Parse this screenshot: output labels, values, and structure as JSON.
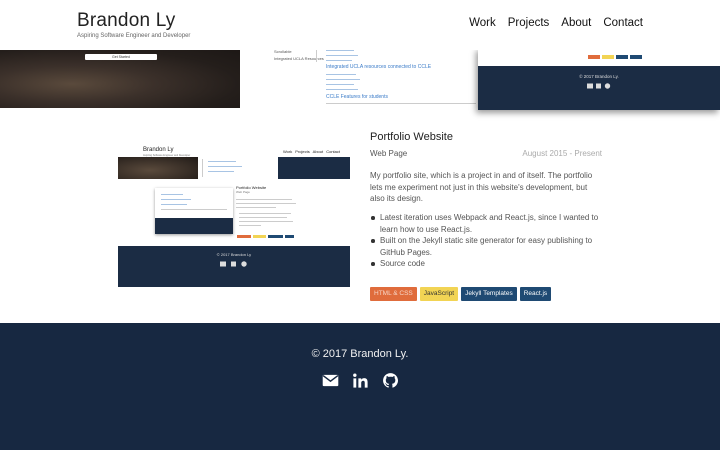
{
  "nav": {
    "brand": "Brandon Ly",
    "tagline": "Aspiring Software Engineer and Developer",
    "links": [
      "Work",
      "Projects",
      "About",
      "Contact"
    ]
  },
  "preview_strip": {
    "button_label": "Get Started",
    "items": [
      "Scrollable",
      "Integrated UCLA Resources"
    ],
    "section_heading_1": "Integrated UCLA resources connected to CCLE",
    "section_heading_2": "CCLE Features for students",
    "copyright": "© 2017 Brandon Ly."
  },
  "project": {
    "title": "Portfolio Website",
    "type": "Web Page",
    "date": "August 2015 - Present",
    "description": "My portfolio site, which is a project in and of itself. The portfolio lets me experiment not just in this website's development, but also its design.",
    "bullets": [
      "Latest iteration uses Webpack and React.js, since I wanted to learn how to use React.js.",
      "Built on the Jekyll static site generator for easy publishing to GitHub Pages.",
      "Source code"
    ],
    "tags": [
      "HTML & CSS",
      "JavaScript",
      "Jekyll Templates",
      "React.js"
    ],
    "tag_colors": [
      "#e06c3c",
      "#f2d454",
      "#1f4a73",
      "#1f4a73"
    ],
    "thumbnail": {
      "brand": "Brandon Ly",
      "menu": "Work Projects About Contact",
      "project_title": "Portfolio Website",
      "project_type": "Web Page",
      "copyright": "© 2017 Brandon Ly"
    }
  },
  "footer": {
    "copyright": "© 2017 Brandon Ly.",
    "icons": [
      "mail-icon",
      "linkedin-icon",
      "github-icon"
    ]
  }
}
